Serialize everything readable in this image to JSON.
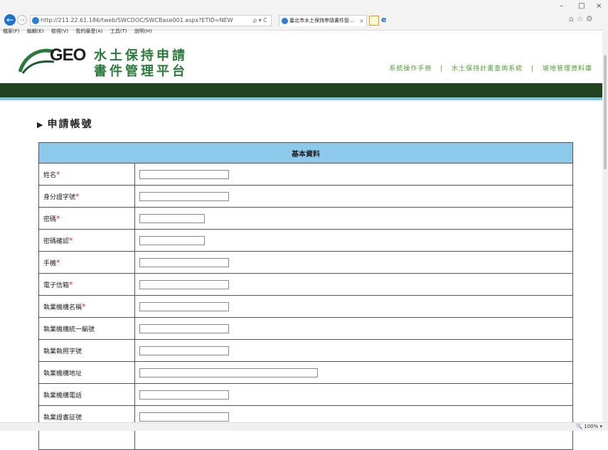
{
  "browser": {
    "url": "http://211.22.61.186/tweb/SWCDOC/SWCBase001.aspx?ETID=NEW",
    "addr_tools": "ρ ▾ С",
    "tab_title": "臺北市水土保持申請書件管...",
    "tab_close": "×",
    "minimize": "–",
    "maximize": "□",
    "close": "×",
    "right_icons": "⌂ ☆ ⚙",
    "menu": [
      "檔案(F)",
      "編輯(E)",
      "檢視(V)",
      "我的最愛(A)",
      "工具(T)",
      "說明(H)"
    ]
  },
  "header": {
    "logo_text": "GEO",
    "logo_line1": "水土保持申請",
    "logo_line2": "書件管理平台",
    "links": [
      "系統操作手冊",
      "水土保持計畫查詢系統",
      "坡地管理資料庫"
    ],
    "separator": "|"
  },
  "page": {
    "title": "申請帳號",
    "title_marker": "▶"
  },
  "form": {
    "section_header": "基本資料",
    "required_mark": "*",
    "fields": [
      {
        "label": "姓名",
        "required": true
      },
      {
        "label": "身分證字號",
        "required": true
      },
      {
        "label": "密碼",
        "required": true
      },
      {
        "label": "密碼確認",
        "required": true
      },
      {
        "label": "手機",
        "required": true
      },
      {
        "label": "電子信箱",
        "required": true
      },
      {
        "label": "執業機構名稱",
        "required": true
      },
      {
        "label": "執業機構統一編號",
        "required": false
      },
      {
        "label": "執業執照字號",
        "required": false
      },
      {
        "label": "執業機構地址",
        "required": false
      },
      {
        "label": "執業機構電話",
        "required": false
      },
      {
        "label": "執業證書証號",
        "required": false
      }
    ]
  },
  "status": {
    "zoom": "🔍 100%  ▾"
  },
  "colors": {
    "accent_green": "#2a7a3a",
    "band_dark": "#22421f",
    "table_header": "#8cc9ea",
    "required": "#e0202a"
  }
}
